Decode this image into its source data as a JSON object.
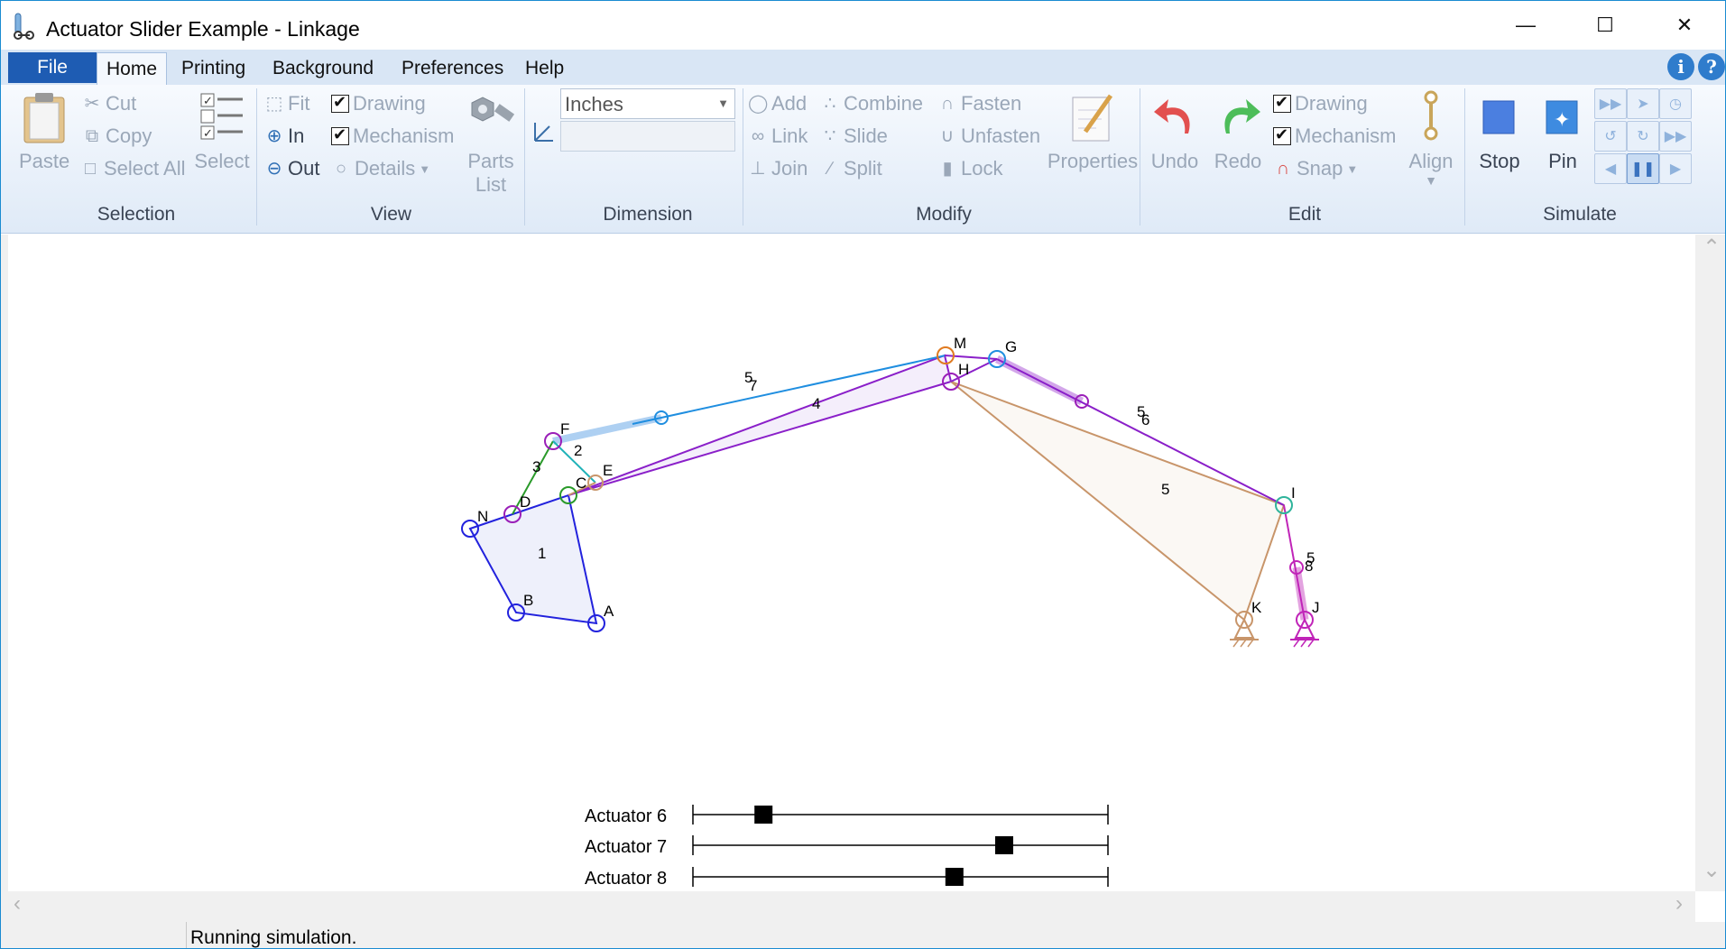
{
  "window": {
    "title": "Actuator Slider Example - Linkage"
  },
  "menu": {
    "file": "File",
    "tabs": [
      "Home",
      "Printing",
      "Background",
      "Preferences",
      "Help"
    ]
  },
  "ribbon": {
    "selection": {
      "label": "Selection",
      "paste": "Paste",
      "cut": "Cut",
      "copy": "Copy",
      "select_all": "Select All",
      "select": "Select"
    },
    "view": {
      "label": "View",
      "fit": "Fit",
      "in": "In",
      "out": "Out",
      "drawing": "Drawing",
      "mechanism": "Mechanism",
      "details": "Details",
      "parts_list_1": "Parts",
      "parts_list_2": "List"
    },
    "dimension": {
      "label": "Dimension",
      "units": "Inches"
    },
    "modify": {
      "label": "Modify",
      "add": "Add",
      "link": "Link",
      "join": "Join",
      "combine": "Combine",
      "slide": "Slide",
      "split": "Split",
      "fasten": "Fasten",
      "unfasten": "Unfasten",
      "lock": "Lock",
      "properties": "Properties"
    },
    "edit": {
      "label": "Edit",
      "undo": "Undo",
      "redo": "Redo",
      "drawing": "Drawing",
      "mechanism": "Mechanism",
      "snap": "Snap",
      "align": "Align"
    },
    "simulate": {
      "label": "Simulate",
      "stop": "Stop",
      "pin": "Pin"
    }
  },
  "drawing": {
    "point_labels": [
      "M",
      "G",
      "H",
      "F",
      "E",
      "C",
      "D",
      "N",
      "B",
      "A",
      "I",
      "K",
      "J"
    ],
    "link_labels": [
      "5",
      "7",
      "4",
      "2",
      "3",
      "1",
      "5",
      "6",
      "5",
      "5",
      "8"
    ]
  },
  "sliders": [
    {
      "label": "Actuator 6",
      "position": 0.17
    },
    {
      "label": "Actuator 7",
      "position": 0.75
    },
    {
      "label": "Actuator 8",
      "position": 0.63
    }
  ],
  "status": {
    "text": "Running simulation."
  },
  "colors": {
    "file_tab": "#1e5cb3",
    "ribbon_bg": "#dfeaf7",
    "accent": "#1a8bd1"
  }
}
